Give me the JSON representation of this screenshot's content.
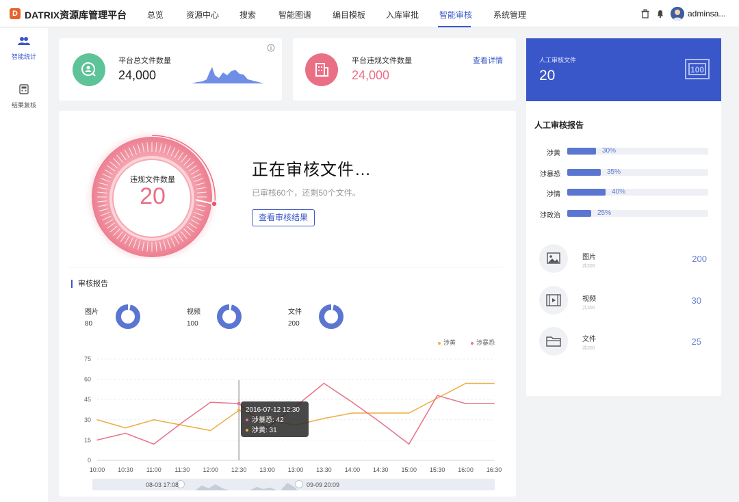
{
  "brand": {
    "logo_letter": "D",
    "title": "DATRIX资源库管理平台"
  },
  "nav": {
    "items": [
      "总览",
      "资源中心",
      "搜索",
      "智能图谱",
      "编目模板",
      "入库审批",
      "智能审核",
      "系统管理"
    ],
    "active": "智能审核"
  },
  "user": {
    "name": "adminsa..."
  },
  "sidebar": {
    "items": [
      {
        "label": "智能统计",
        "icon": "users-icon"
      },
      {
        "label": "结果复核",
        "icon": "calculator-icon"
      }
    ]
  },
  "stats": {
    "total_label": "平台总文件数量",
    "total_value": "24,000",
    "violation_label": "平台违规文件数量",
    "violation_value": "24,000",
    "detail_link": "查看详情"
  },
  "gauge": {
    "label": "违规文件数量",
    "value": "20",
    "progress": 0.55
  },
  "review_status": {
    "title": "正在审核文件…",
    "subtitle": "已审核60个，还剩50个文件。",
    "button": "查看审核结果"
  },
  "report": {
    "title": "审核报告",
    "donuts": [
      {
        "label": "图片",
        "value": "80"
      },
      {
        "label": "视频",
        "value": "100"
      },
      {
        "label": "文件",
        "value": "200"
      }
    ]
  },
  "chart_data": {
    "type": "line",
    "x": [
      "10:00",
      "10:30",
      "11:00",
      "11:30",
      "12:00",
      "12:30",
      "13:00",
      "13:00",
      "13:30",
      "14:00",
      "14:30",
      "15:00",
      "15:30",
      "16:00",
      "16:30"
    ],
    "series": [
      {
        "name": "涉黄",
        "color": "#f0b04a",
        "values": [
          30,
          24,
          30,
          26,
          22,
          37,
          30,
          26,
          31,
          35,
          35,
          35,
          46,
          57,
          57
        ]
      },
      {
        "name": "涉暴恐",
        "color": "#e8768c",
        "values": [
          15,
          20,
          12,
          28,
          43,
          42,
          24,
          40,
          57,
          43,
          28,
          12,
          48,
          42,
          42
        ]
      }
    ],
    "y_ticks": [
      0,
      15,
      30,
      45,
      60,
      75
    ],
    "ylim": [
      0,
      75
    ],
    "legend_position": "top-right",
    "tooltip": {
      "time": "2016-07-12 12:30",
      "series1": "涉暴恐: 42",
      "series2": "涉黄: 31"
    },
    "slider": {
      "start": "08-03 17:08",
      "end": "09-09 20:09"
    }
  },
  "manual": {
    "card_label": "人工审核文件",
    "card_value": "20",
    "report_title": "人工审核报告",
    "bars": [
      {
        "label": "涉黄",
        "pct": "30%",
        "value": 0.3
      },
      {
        "label": "涉暴恐",
        "pct": "35%",
        "value": 0.35
      },
      {
        "label": "涉情",
        "pct": "40%",
        "value": 0.4
      },
      {
        "label": "涉政治",
        "pct": "25%",
        "value": 0.25
      }
    ],
    "types": [
      {
        "name": "图片",
        "sub": "共300",
        "count": "200",
        "icon": "image-icon"
      },
      {
        "name": "视频",
        "sub": "共300",
        "count": "30",
        "icon": "video-icon"
      },
      {
        "name": "文件",
        "sub": "共300",
        "count": "25",
        "icon": "folder-icon"
      }
    ]
  }
}
